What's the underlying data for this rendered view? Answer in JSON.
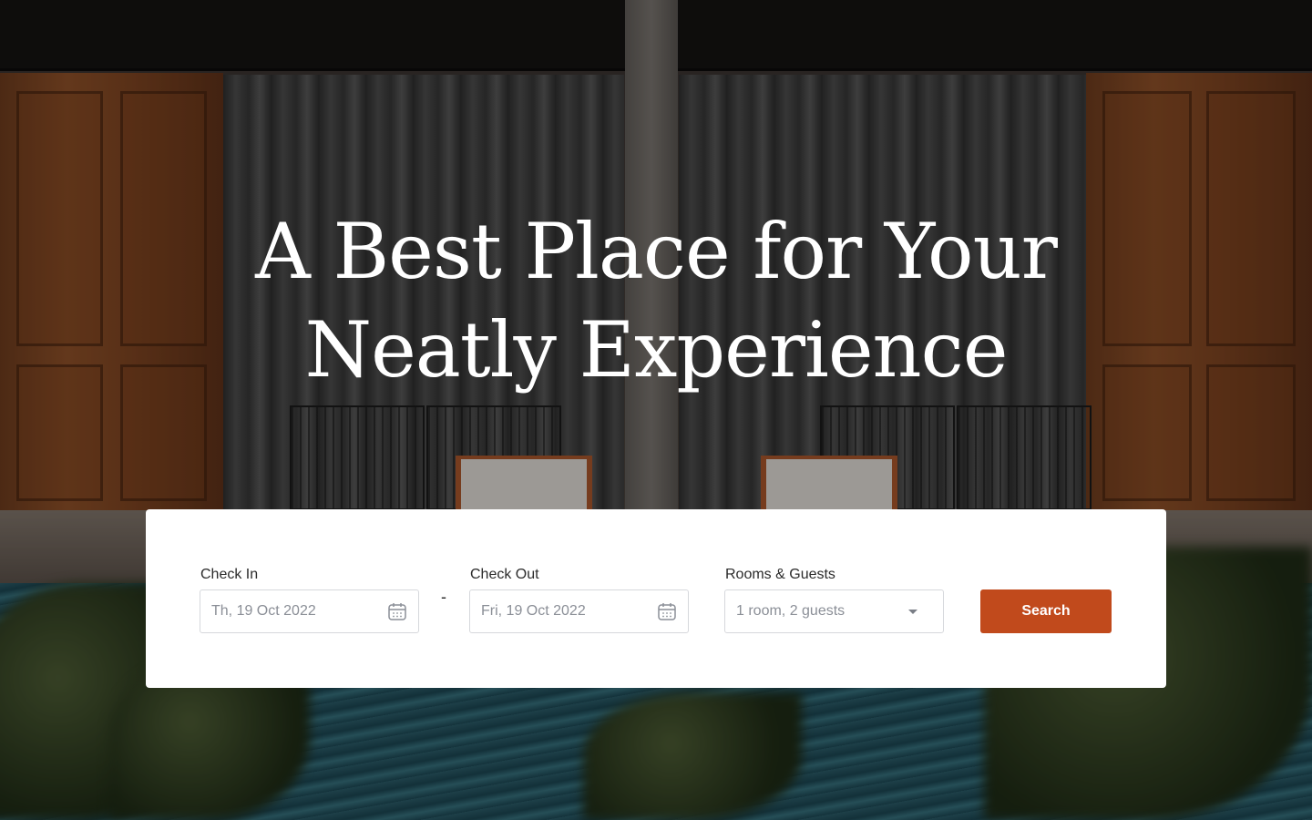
{
  "hero": {
    "headline_line1": "A Best Place for Your",
    "headline_line2": "Neatly Experience"
  },
  "booking": {
    "check_in_label": "Check In",
    "check_in_value": "Th, 19 Oct 2022",
    "separator": "-",
    "check_out_label": "Check Out",
    "check_out_value": "Fri, 19 Oct 2022",
    "guests_label": "Rooms & Guests",
    "guests_value": "1 room, 2 guests",
    "search_label": "Search"
  },
  "icons": {
    "check_in": "calendar-icon",
    "check_out": "calendar-icon",
    "guests": "chevron-down-icon"
  },
  "colors": {
    "accent": "#c14a1c",
    "card_bg": "#ffffff",
    "headline": "#ffffff"
  }
}
